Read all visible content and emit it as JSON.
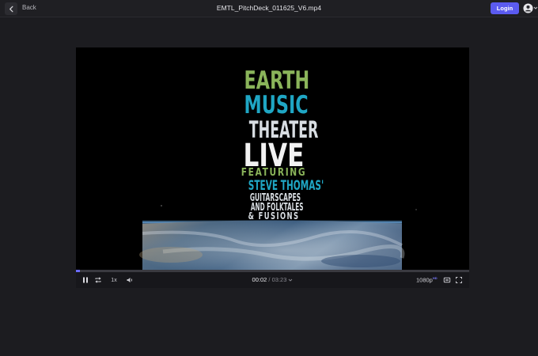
{
  "topbar": {
    "back_label": "Back",
    "file_title": "EMTL_PitchDeck_011625_V6.mp4",
    "login_label": "Login"
  },
  "poster": {
    "line1": "EARTH",
    "line2": "MUSIC",
    "line3": "THEATER",
    "line4": "LIVE",
    "line5": "FEATURING",
    "line6": "STEVE THOMAS'",
    "line7": "GUITARSCAPES",
    "line8": "AND FOLKTALES",
    "line9": "& FUSIONS",
    "colors": {
      "green": "#8ab45a",
      "teal": "#1fa6c4",
      "white": "#f2f2f2",
      "light": "#d8dde2"
    }
  },
  "player": {
    "progress": 0.0105,
    "speed_label": "1x",
    "current_time": "00:02",
    "separator": "/",
    "duration": "03:23",
    "quality_label": "1080p",
    "quality_badge": "HD"
  },
  "icons": {
    "back": "chevron-left-icon",
    "avatar": "user-icon",
    "pause": "pause-icon",
    "loop": "loop-icon",
    "volume": "volume-icon",
    "subtitles": "subtitles-icon",
    "fullscreen": "fullscreen-icon"
  },
  "colors": {
    "accent": "#5b5bf0",
    "background": "#1c1c20",
    "progress": "#6a6aff"
  }
}
